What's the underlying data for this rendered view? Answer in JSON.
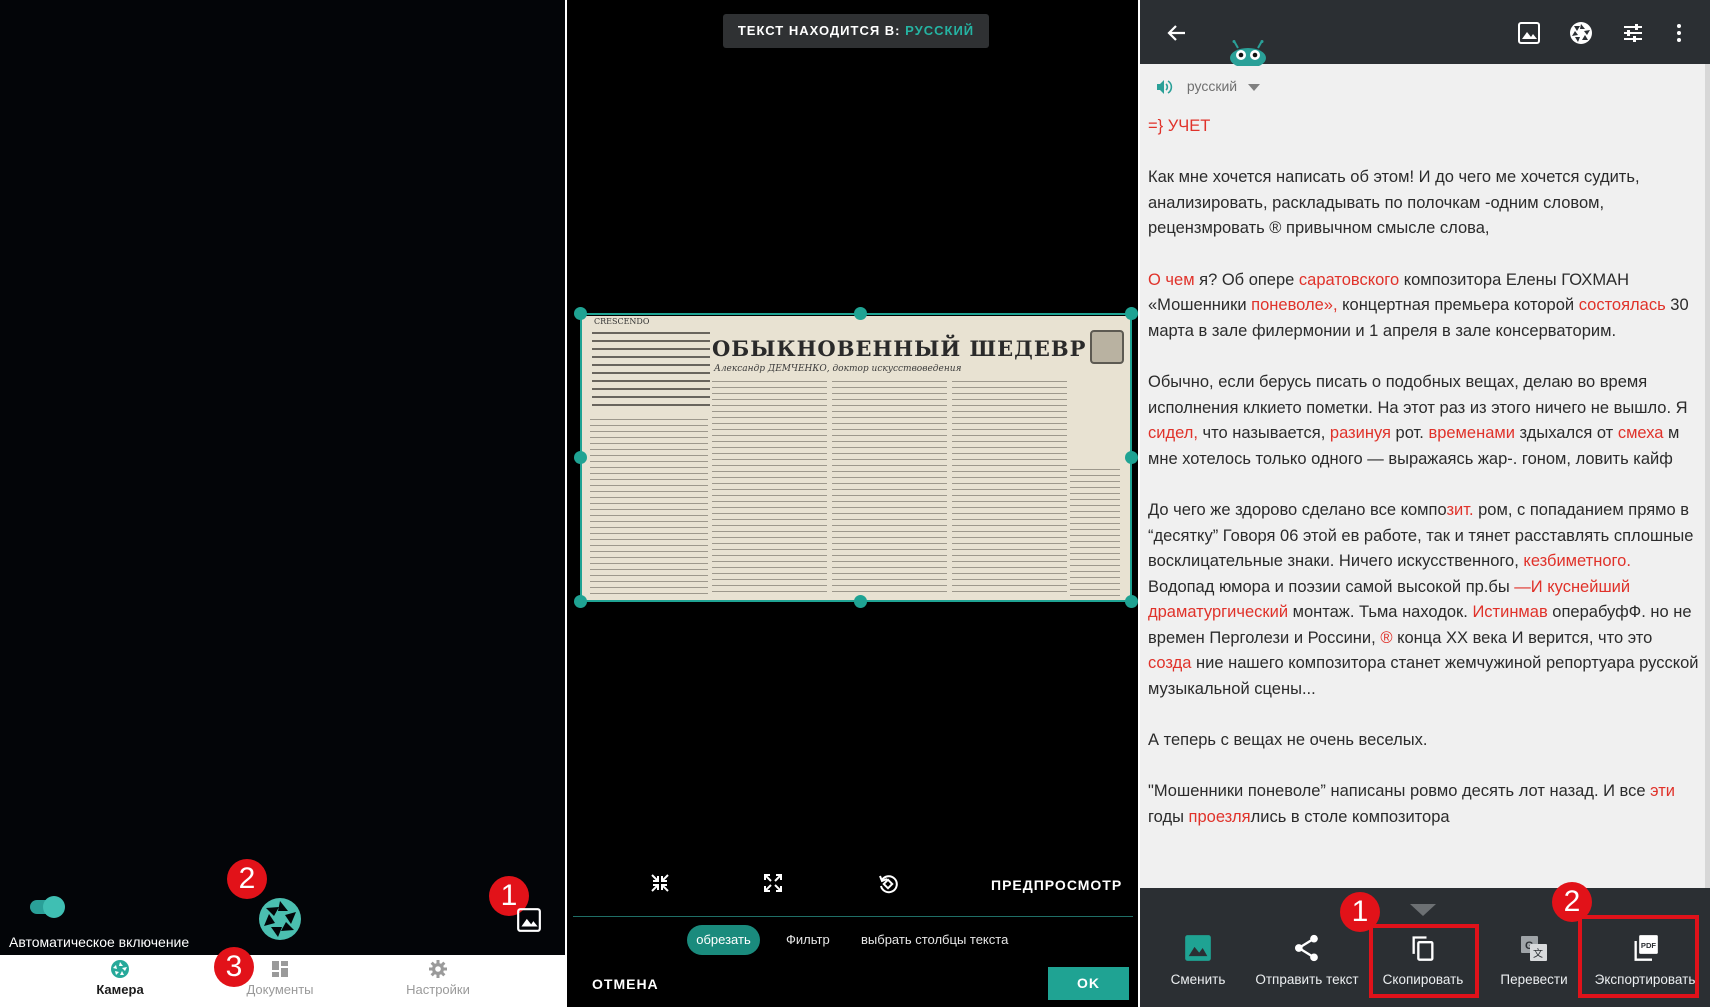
{
  "camera_screen": {
    "auto_toggle_label": "Автоматическое включение",
    "auto_toggle_on": true,
    "badges": {
      "shutter": "2",
      "gallery": "1",
      "documents": "3"
    },
    "nav": [
      {
        "label": "Камера",
        "icon": "camera-icon",
        "active": true
      },
      {
        "label": "Документы",
        "icon": "dashboard-icon",
        "active": false
      },
      {
        "label": "Настройки",
        "icon": "gear-icon",
        "active": false
      }
    ]
  },
  "crop_screen": {
    "language_prefix": "ТЕКСТ НАХОДИТСЯ В:",
    "language_value": "РУССКИЙ",
    "document_headline": "ОБЫКНОВЕННЫЙ ШЕДЕВР",
    "document_author": "Александр ДЕМЧЕНКО, доктор искусствоведения",
    "document_section": "CRESCENDO",
    "preview_label": "ПРЕДПРОСМОТР",
    "tabs": [
      "обрезать",
      "Фильтр",
      "выбрать столбцы текста"
    ],
    "active_tab": "обрезать",
    "cancel_label": "ОТМЕНА",
    "ok_label": "OK",
    "accent_color": "#1fa393"
  },
  "result_screen": {
    "language": "русский",
    "ocr_paragraphs": [
      [
        {
          "t": "=} УЧЕТ",
          "r": true
        }
      ],
      [
        {
          "t": "Как мне хочется написать об этом! И до чего ме хочется судить, анализировать, раскладывать по полочкам -одним словом, рецензмровать ® привычном смысле слова,",
          "r": false
        }
      ],
      [
        {
          "t": "О чем",
          "r": true
        },
        {
          "t": " я? Об опере ",
          "r": false
        },
        {
          "t": "саратовского",
          "r": true
        },
        {
          "t": " композитора Елены ГОХМАН «Мошенники ",
          "r": false
        },
        {
          "t": "поневоле»,",
          "r": true
        },
        {
          "t": " концертная премьера которой ",
          "r": false
        },
        {
          "t": "состоялась",
          "r": true
        },
        {
          "t": " 30 марта в зале филермонии и 1 апреля в зале консерваторим.",
          "r": false
        }
      ],
      [
        {
          "t": "Обычно, если берусь писать о подобных вещах, делаю во время исполнения клкието пометки. На этот раз из этого ничего не вышло. Я ",
          "r": false
        },
        {
          "t": "сидел,",
          "r": true
        },
        {
          "t": " что называется, ",
          "r": false
        },
        {
          "t": "разинуя",
          "r": true
        },
        {
          "t": " рот. ",
          "r": false
        },
        {
          "t": "временами",
          "r": true
        },
        {
          "t": " здыхался от ",
          "r": false
        },
        {
          "t": "смеха",
          "r": true
        },
        {
          "t": " м мне хотелось только одного — выражаясь жар-. гоном, ловить кайф",
          "r": false
        }
      ],
      [
        {
          "t": "До чего же здорово сделано все компо",
          "r": false
        },
        {
          "t": "зит.",
          "r": true
        },
        {
          "t": " ром, с попаданием прямо в “десятку” Говоря 06 этой ев работе, так и тянет расставлять сплошные восклицательные знаки. Ничего искусственного, ",
          "r": false
        },
        {
          "t": "кезбиметного.",
          "r": true
        },
        {
          "t": " Водопад юмора и поэзии самой высокой пр.бы ",
          "r": false
        },
        {
          "t": "—И куснейший драматургический",
          "r": true
        },
        {
          "t": " монтаж. Тьма находок. ",
          "r": false
        },
        {
          "t": "Истинмав",
          "r": true
        },
        {
          "t": " операбуфФ. но не времен Перголези и Россини, ",
          "r": false
        },
        {
          "t": "®",
          "r": true
        },
        {
          "t": " конца ХХ века И верится, что это ",
          "r": false
        },
        {
          "t": "созда",
          "r": true
        },
        {
          "t": " ние нашего композитора станет жемчужиной репортуара русской музыкальной сцены...",
          "r": false
        }
      ],
      [
        {
          "t": "А теперь с вещах не очень веселых.",
          "r": false
        }
      ],
      [
        {
          "t": "\"Мошенники поневоле” написаны ровмо десять лот назад. И все ",
          "r": false
        },
        {
          "t": "эти",
          "r": true
        },
        {
          "t": " годы ",
          "r": false
        },
        {
          "t": "проезля",
          "r": true
        },
        {
          "t": "лись в столе композитора",
          "r": false
        }
      ]
    ],
    "actions": [
      {
        "label": "Сменить",
        "icon": "image-icon"
      },
      {
        "label": "Отправить текст",
        "icon": "share-icon"
      },
      {
        "label": "Скопировать",
        "icon": "copy-icon"
      },
      {
        "label": "Перевести",
        "icon": "translate-icon"
      },
      {
        "label": "Экспортировать",
        "icon": "pdf-icon"
      }
    ],
    "badges": {
      "copy": "1",
      "export": "2"
    },
    "highlight_color": "#e0121a",
    "misrecognition_color": "#e0322a"
  }
}
